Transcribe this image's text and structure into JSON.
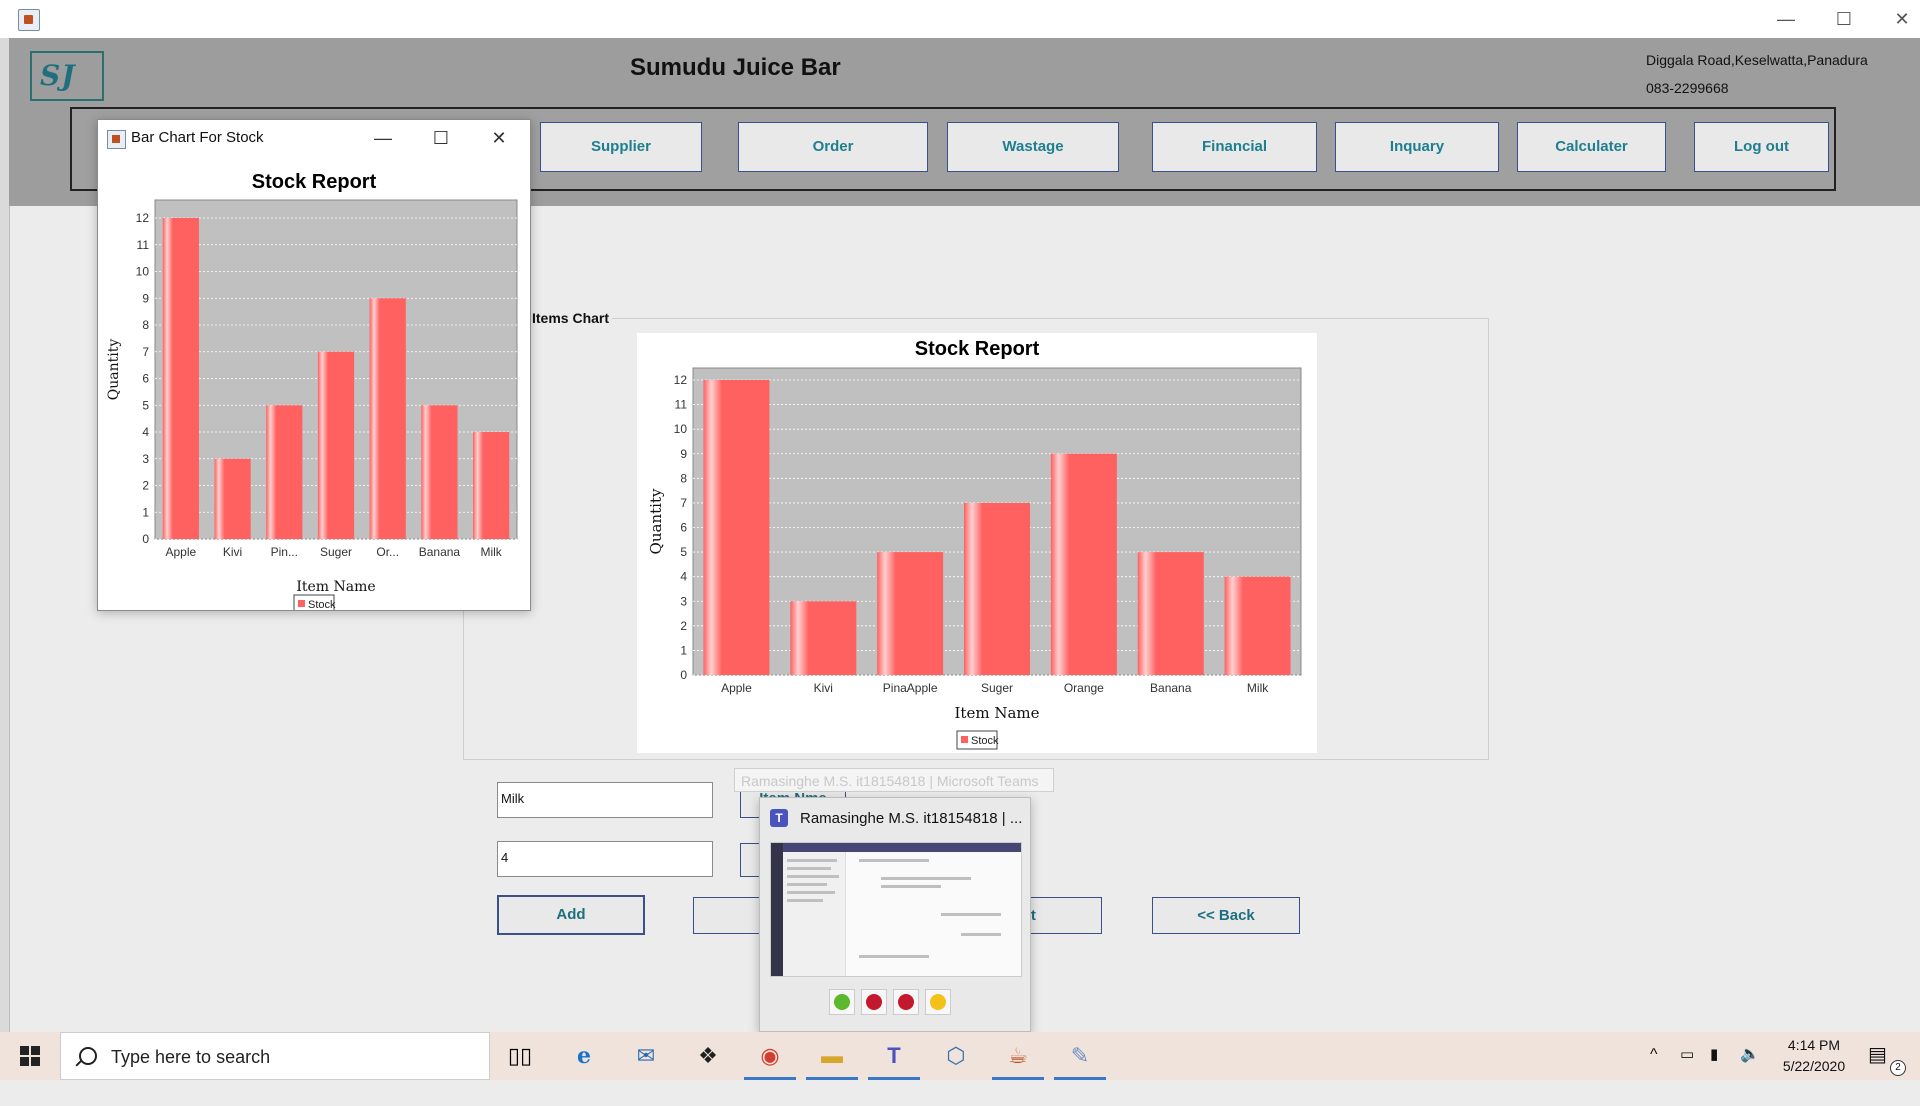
{
  "window": {
    "minimize": "—",
    "maximize": "☐",
    "close": "✕"
  },
  "header": {
    "logo": "SJ",
    "title": "Sumudu Juice Bar",
    "address": "Diggala Road,Keselwatta,Panadura",
    "phone": "083-2299668"
  },
  "nav": {
    "items": [
      {
        "label": "Supplier"
      },
      {
        "label": "Order"
      },
      {
        "label": "Wastage"
      },
      {
        "label": "Financial"
      },
      {
        "label": "Inquary"
      },
      {
        "label": "Calculater"
      },
      {
        "label": "Log out"
      }
    ]
  },
  "panel": {
    "label": "Items Chart"
  },
  "chart_data": [
    {
      "type": "bar",
      "title": "Stock Report",
      "xlabel": "Item Name",
      "ylabel": "Quantity",
      "categories": [
        "Apple",
        "Kivi",
        "PinaApple",
        "Suger",
        "Orange",
        "Banana",
        "Milk"
      ],
      "series": [
        {
          "name": "Stock",
          "values": [
            12,
            3,
            5,
            7,
            9,
            5,
            4
          ]
        }
      ],
      "ylim": [
        0,
        12
      ],
      "yticks": [
        0,
        1,
        2,
        3,
        4,
        5,
        6,
        7,
        8,
        9,
        10,
        11,
        12
      ],
      "grid": true,
      "legend": "bottom-center",
      "bar_color": "#ff6060",
      "plot_bg": "#c0c0c0"
    },
    {
      "type": "bar",
      "title": "Stock Report",
      "xlabel": "Item Name",
      "ylabel": "Quantity",
      "categories": [
        "Apple",
        "Kivi",
        "Pin...",
        "Suger",
        "Or...",
        "Banana",
        "Milk"
      ],
      "series": [
        {
          "name": "Stock",
          "values": [
            12,
            3,
            5,
            7,
            9,
            5,
            4
          ]
        }
      ],
      "ylim": [
        0,
        12
      ],
      "yticks": [
        0,
        1,
        2,
        3,
        4,
        5,
        6,
        7,
        8,
        9,
        10,
        11,
        12
      ],
      "grid": true,
      "legend": "bottom-center",
      "bar_color": "#ff6060",
      "plot_bg": "#c0c0c0"
    }
  ],
  "form": {
    "item_name_value": "Milk",
    "quantity_value": "4",
    "item_name_button": "Item Nme",
    "add_button": "Add",
    "chart_button": "rt",
    "back_button": "<< Back"
  },
  "tooltip": "Ramasinghe M.S. it18154818 | Microsoft Teams",
  "popup": {
    "title": "Bar Chart For Stock",
    "minimize": "—",
    "maximize": "☐",
    "close": "✕"
  },
  "teams_preview": {
    "title": "Ramasinghe M.S. it18154818 | ...",
    "status_colors": [
      "#5cb82c",
      "#c4182e",
      "#c4182e",
      "#f4c01a"
    ]
  },
  "taskbar": {
    "search_placeholder": "Type here to search",
    "time": "4:14 PM",
    "date": "5/22/2020",
    "notification_count": "2",
    "apps": [
      "task-view",
      "edge",
      "mail",
      "dropbox",
      "chrome",
      "file-explorer",
      "teams",
      "virtualbox",
      "java",
      "paint"
    ]
  }
}
